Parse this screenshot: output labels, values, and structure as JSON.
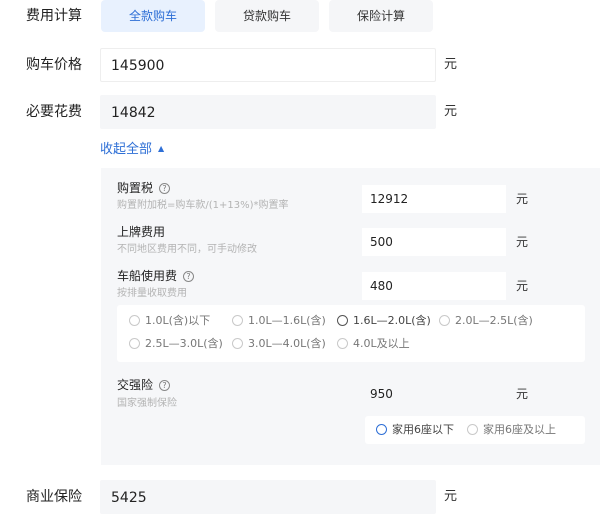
{
  "calc": {
    "label": "费用计算",
    "tabs": [
      {
        "label": "全款购车",
        "active": true
      },
      {
        "label": "贷款购车",
        "active": false
      },
      {
        "label": "保险计算",
        "active": false
      }
    ]
  },
  "price": {
    "label": "购车价格",
    "value": "145900",
    "unit": "元"
  },
  "required": {
    "label": "必要花费",
    "value": "14842",
    "unit": "元"
  },
  "collapse": {
    "label": "收起全部",
    "arrow": "▲"
  },
  "purchase_tax": {
    "title": "购置税",
    "help": "?",
    "desc": "购置附加税=购车款/(1+13%)*购置率",
    "value": "12912",
    "unit": "元"
  },
  "registration": {
    "title": "上牌费用",
    "desc": "不同地区费用不同，可手动修改",
    "value": "500",
    "unit": "元"
  },
  "vehicle_tax": {
    "title": "车船使用费",
    "help": "?",
    "desc": "按排量收取费用",
    "value": "480",
    "unit": "元",
    "options": [
      "1.0L(含)以下",
      "1.0L—1.6L(含)",
      "1.6L—2.0L(含)",
      "2.0L—2.5L(含)",
      "2.5L—3.0L(含)",
      "3.0L—4.0L(含)",
      "4.0L及以上"
    ],
    "selected_index": 2
  },
  "compulsory": {
    "title": "交强险",
    "help": "?",
    "desc": "国家强制保险",
    "value": "950",
    "unit": "元",
    "options": [
      "家用6座以下",
      "家用6座及以上"
    ],
    "selected_index": 0
  },
  "commercial": {
    "label": "商业保险",
    "value": "5425",
    "unit": "元"
  },
  "colors": {
    "accent": "#2e6fd6",
    "panel": "#f6f7f9",
    "tab_active_bg": "#e8f1fe"
  }
}
